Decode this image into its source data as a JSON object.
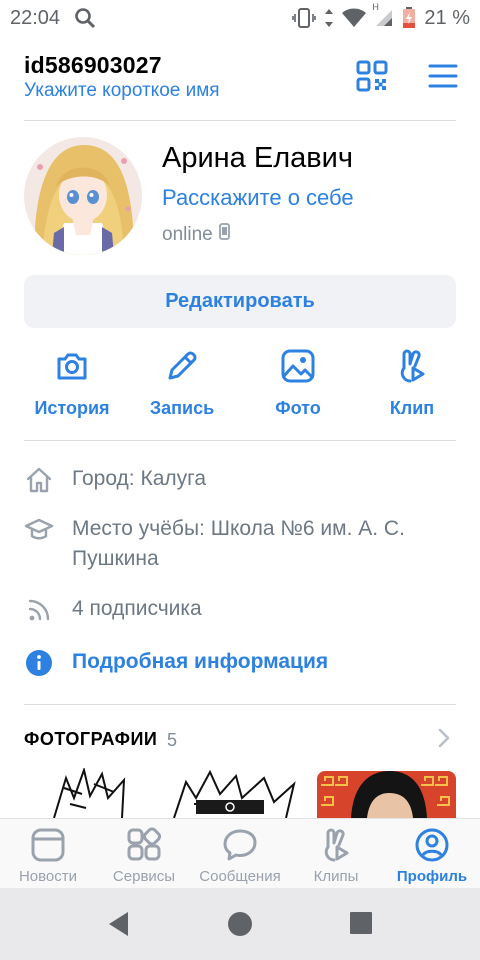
{
  "status_bar": {
    "time": "22:04",
    "battery_percent": "21 %",
    "network_label": "H"
  },
  "header": {
    "user_id": "id586903027",
    "short_name_link": "Укажите короткое имя"
  },
  "profile": {
    "name": "Арина Елавич",
    "about_link": "Расскажите о себе",
    "status": "online",
    "edit_button": "Редактировать"
  },
  "actions": [
    {
      "label": "История",
      "icon": "camera-icon"
    },
    {
      "label": "Запись",
      "icon": "pencil-icon"
    },
    {
      "label": "Фото",
      "icon": "photo-icon"
    },
    {
      "label": "Клип",
      "icon": "clip-icon"
    }
  ],
  "info": {
    "city": "Город: Калуга",
    "school_line1": "Место учёбы: Школа №6 им. А. С.",
    "school_line2": "Пушкина",
    "followers": "4 подписчика",
    "details_link": "Подробная информация"
  },
  "photos": {
    "title": "ФОТОГРАФИИ",
    "count": "5"
  },
  "tabs": [
    {
      "label": "Новости",
      "icon": "news-icon",
      "active": false
    },
    {
      "label": "Сервисы",
      "icon": "services-icon",
      "active": false
    },
    {
      "label": "Сообщения",
      "icon": "messages-icon",
      "active": false
    },
    {
      "label": "Клипы",
      "icon": "clips-icon",
      "active": false
    },
    {
      "label": "Профиль",
      "icon": "profile-icon",
      "active": true
    }
  ],
  "colors": {
    "accent": "#2d81e0",
    "secondary_text": "#818c99",
    "button_bg": "#f0f2f5"
  }
}
